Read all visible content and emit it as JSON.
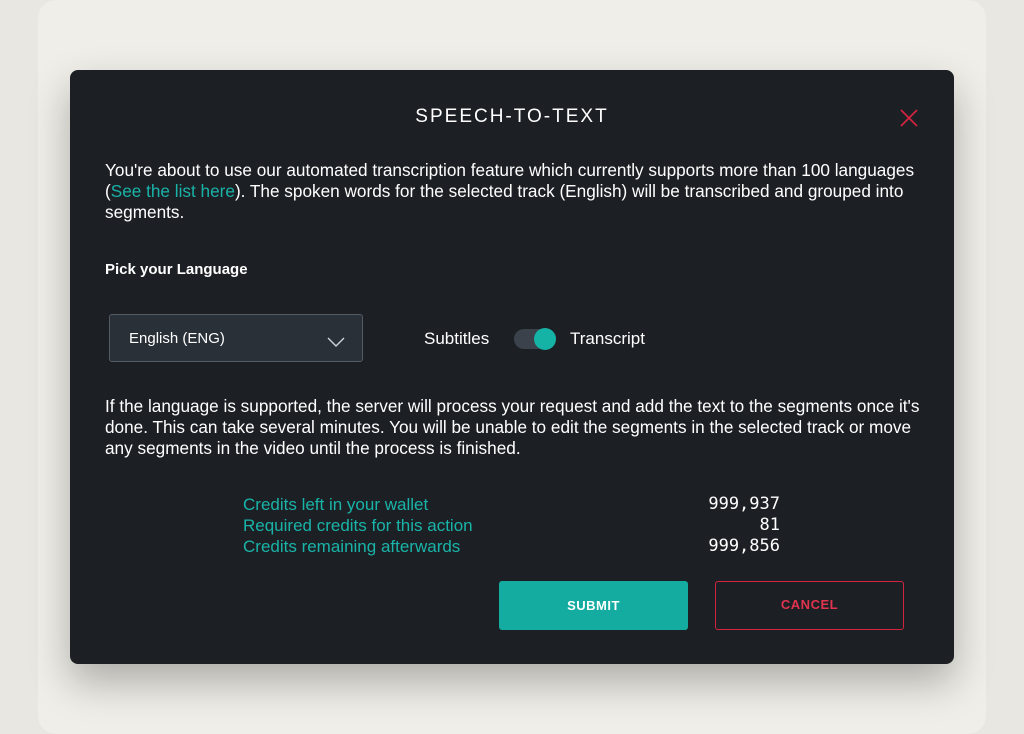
{
  "dialog": {
    "title": "SPEECH-TO-TEXT",
    "close_icon": "close-icon",
    "intro": {
      "text_before_link": "You're about to use our automated transcription feature which currently supports more than 100 languages (",
      "link_text": "See the list here",
      "text_after_link": "). The spoken words for the selected track (English) will be transcribed and grouped into segments."
    },
    "pick_language_label": "Pick your Language",
    "language_select": {
      "value": "English (ENG)",
      "icon": "chevron-down-icon"
    },
    "mode_toggle": {
      "left_label": "Subtitles",
      "right_label": "Transcript",
      "state": "Transcript"
    },
    "info_text": "If the language is supported, the server will process your request and add the text to the segments once it's done. This can take several minutes. You will be unable to edit the segments in the selected track or move any segments in the video until the process is finished.",
    "credits": [
      {
        "label": "Credits left in your wallet",
        "value": "999,937"
      },
      {
        "label": "Required credits for this action",
        "value": "81"
      },
      {
        "label": "Credits remaining afterwards",
        "value": "999,856"
      }
    ],
    "buttons": {
      "submit": "SUBMIT",
      "cancel": "CANCEL"
    }
  },
  "colors": {
    "modal_bg": "#1c2025",
    "accent": "#14aba0",
    "danger": "#d2243f",
    "page_bg": "#efeee8"
  }
}
